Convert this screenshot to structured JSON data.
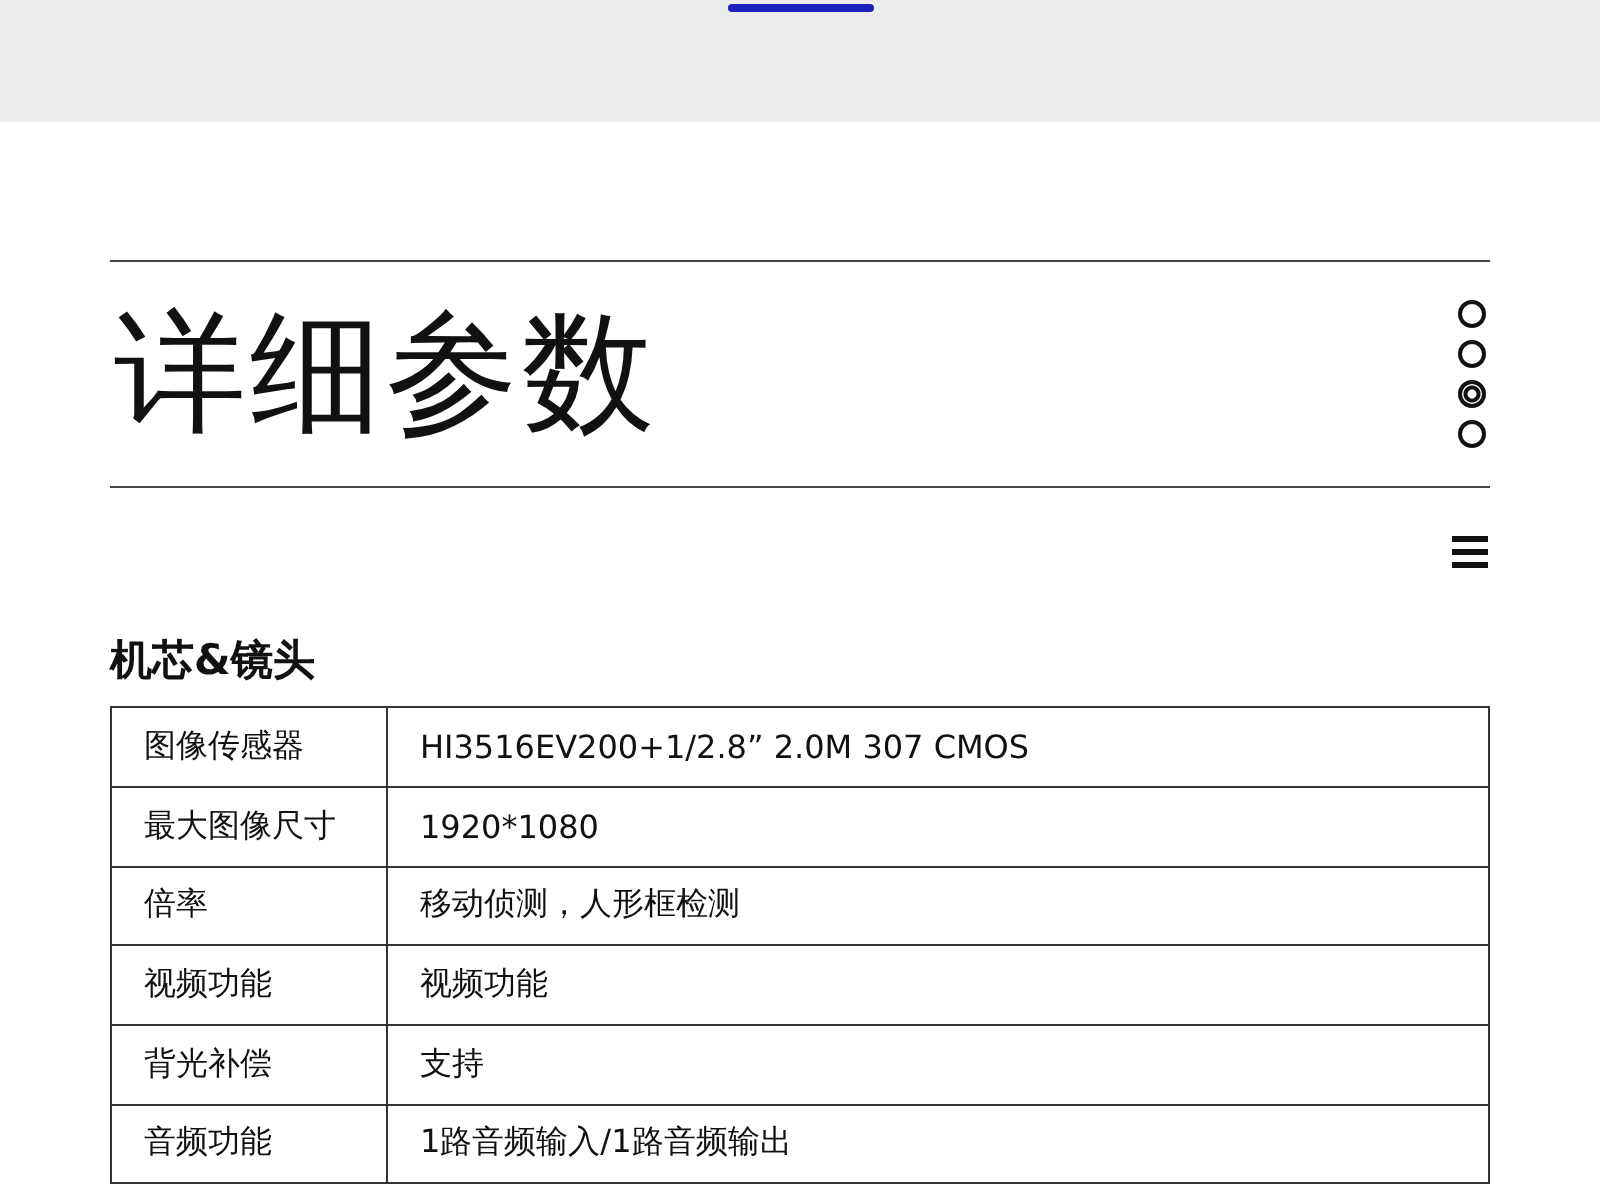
{
  "title": "详细参数",
  "page_dots": [
    {
      "selected": false
    },
    {
      "selected": false
    },
    {
      "selected": true
    },
    {
      "selected": false
    }
  ],
  "section": {
    "heading": "机芯&镜头",
    "rows": [
      {
        "label": "图像传感器",
        "value": "HI3516EV200+1/2.8”  2.0M 307 CMOS"
      },
      {
        "label": "最大图像尺寸",
        "value": "1920*1080"
      },
      {
        "label": "倍率",
        "value": "移动侦测，人形框检测"
      },
      {
        "label": "视频功能",
        "value": "视频功能"
      },
      {
        "label": "背光补偿",
        "value": "支持"
      },
      {
        "label": "音频功能",
        "value": "1路音频输入/1路音频输出"
      }
    ]
  }
}
